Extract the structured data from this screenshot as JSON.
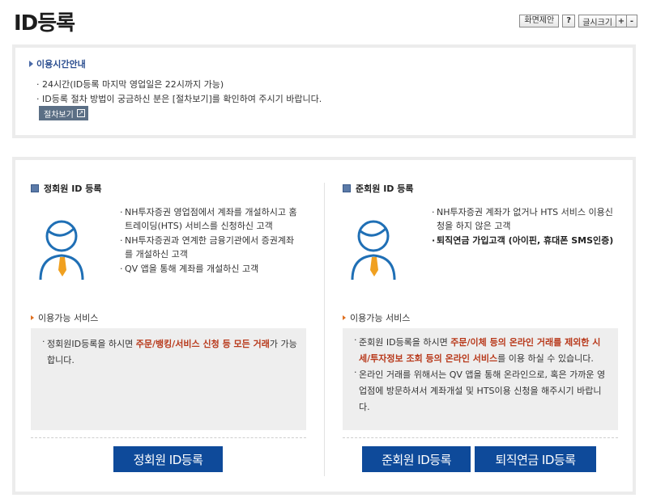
{
  "page": {
    "title": "ID등록"
  },
  "tools": {
    "suggest_label": "화면제안",
    "help_label": "?",
    "font_size_label": "글시크기",
    "font_plus": "+",
    "font_minus": "-"
  },
  "notice": {
    "title": "이용시간안내",
    "lines": [
      "· 24시간(ID등록 마지막 영업일은 22시까지 가능)",
      "· ID등록 절차 방법이 궁금하신 분은 [절차보기]를 확인하여 주시기 바랍니다."
    ],
    "procedure_button": "절차보기"
  },
  "regular": {
    "title": "정회원 ID 등록",
    "desc": [
      "NH투자증권 영업점에서 계좌를 개설하시고 홈트레이딩(HTS) 서비스를 신청하신 고객",
      "NH투자증권과 연계한 금융기관에서 증권계좌를 개설하신 고객",
      "QV 앱을 통해 계좌를 개설하신 고객"
    ],
    "service_label": "이용가능 서비스",
    "service_pre": "정회원ID등록을 하시면 ",
    "service_em": "주문/뱅킹/서비스 신청 등 모든 거래",
    "service_post": "가 가능합니다.",
    "button": "정회원 ID등록"
  },
  "associate": {
    "title": "준회원 ID 등록",
    "desc": [
      "NH투자증권 계좌가 없거나 HTS 서비스 이용신청을 하지 않은 고객"
    ],
    "desc_bold": "퇴직연금 가입고객 (아이핀, 휴대폰 SMS인증)",
    "service_label": "이용가능 서비스",
    "service1_pre": "준회원 ID등록을 하시면 ",
    "service1_em": "주문/이체 등의 온라인 거래를 제외한 시세/투자정보 조회 등의 온라인 서비스",
    "service1_post": "를 이용 하실 수 있습니다.",
    "service2": "온라인 거래를 위해서는 QV 앱을 통해 온라인으로, 혹은 가까운 영업점에 방문하셔서 계좌개설 및 HTS이용 신청을 해주시기 바랍니다.",
    "button_associate": "준회원 ID등록",
    "button_pension": "퇴직연금 ID등록"
  },
  "colors": {
    "button_blue": "#0e4a9a",
    "emphasis_red": "#b8391b",
    "avatar_blue": "#1f6fb5",
    "tie_orange": "#f0a020"
  }
}
